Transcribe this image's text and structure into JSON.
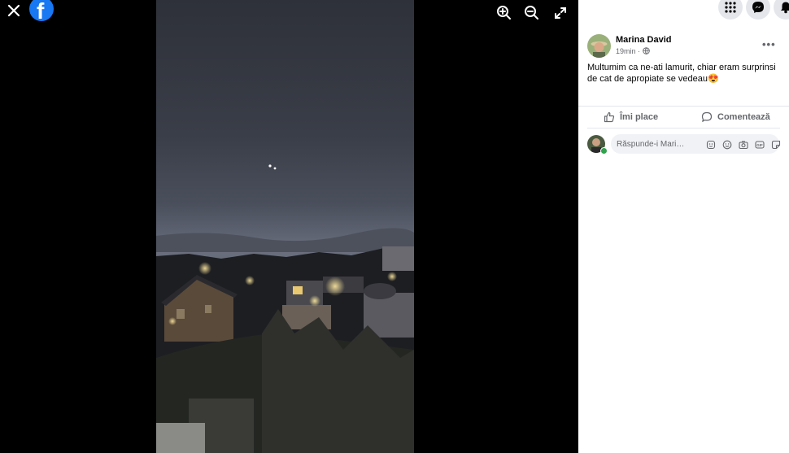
{
  "viewer": {
    "icons": [
      "close-icon",
      "facebook-logo",
      "zoom-in-icon",
      "zoom-out-icon",
      "fullscreen-icon"
    ]
  },
  "header": {
    "icons": [
      "menu-grid-icon",
      "messenger-icon",
      "notifications-icon"
    ]
  },
  "post": {
    "author": "Marina David",
    "time": "19min ·",
    "visibility_icon": "globe-icon",
    "text": "Multumim ca ne-ati lamurit, chiar eram surprinsi de cat de apropiate se vedeau😍",
    "more_label": "•••"
  },
  "actions": {
    "like_label": "Îmi place",
    "comment_label": "Comentează"
  },
  "reply": {
    "placeholder": "Răspunde-i Mari…",
    "icons": [
      "avatar-sticker-icon",
      "emoji-icon",
      "camera-icon",
      "gif-icon",
      "sticker-icon"
    ]
  },
  "colors": {
    "facebook_blue": "#1877f2",
    "panel_bg": "#ffffff",
    "viewer_bg": "#000000",
    "muted_text": "#65676b"
  }
}
